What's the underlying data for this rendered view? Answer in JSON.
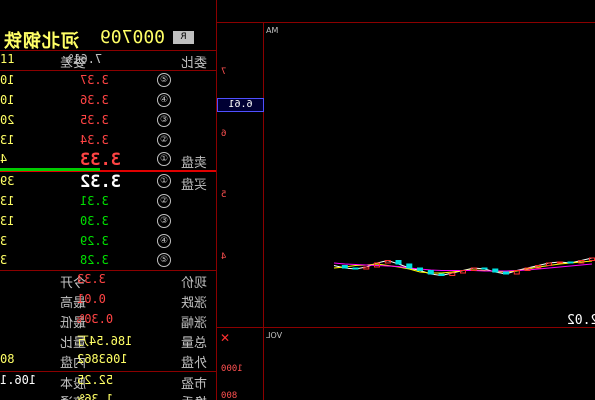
{
  "header": {
    "stock_name": "河北钢铁",
    "stock_code": "000709",
    "badge": "R"
  },
  "order_book": {
    "header_left": "11",
    "header_ratio_value": "7.61%",
    "header_ratio_label": "委差",
    "header_label": "委比",
    "sell_label": "卖盘",
    "buy_label": "买盘",
    "sells": [
      {
        "index": "⑤",
        "price": "3.37",
        "volume": "10"
      },
      {
        "index": "④",
        "price": "3.36",
        "volume": "10"
      },
      {
        "index": "③",
        "price": "3.35",
        "volume": "20"
      },
      {
        "index": "②",
        "price": "3.34",
        "volume": "13"
      },
      {
        "index": "①",
        "price": "3.33",
        "volume": "4"
      }
    ],
    "buys": [
      {
        "index": "①",
        "price": "3.32",
        "volume": "39"
      },
      {
        "index": "②",
        "price": "3.31",
        "volume": "13"
      },
      {
        "index": "③",
        "price": "3.30",
        "volume": "13"
      },
      {
        "index": "④",
        "price": "3.29",
        "volume": "3"
      },
      {
        "index": "⑤",
        "price": "3.28",
        "volume": "3"
      }
    ]
  },
  "stats": [
    {
      "l_key": "现价",
      "r_val": "3.33",
      "r_key": "今开",
      "l_val": ""
    },
    {
      "l_key": "涨跌",
      "r_val": "0.01",
      "r_key": "最高",
      "l_val": ""
    },
    {
      "l_key": "涨幅",
      "r_val": "0.30%",
      "r_key": "最低",
      "l_val": ""
    },
    {
      "l_key": "总量",
      "r_val": "186.54万",
      "r_key": "量比",
      "l_val": ""
    },
    {
      "l_key": "外盘",
      "r_val": "1063862",
      "r_key": "内盘",
      "l_val": "80"
    },
    {
      "l_key": "市盈",
      "r_val": "52.25",
      "r_key": "股本",
      "l_val": "106.1"
    },
    {
      "l_key": "换手",
      "r_val": "1.36%",
      "r_key": "流通",
      "l_val": ""
    }
  ],
  "chart": {
    "ma_label": "MA",
    "vol_label": "VOL",
    "current_price_box": "6.61",
    "y_ticks": [
      "7",
      "6",
      "5",
      "4"
    ],
    "vol_ticks": [
      "1000",
      "800"
    ],
    "low_label": "2.02"
  },
  "chart_data": {
    "type": "line",
    "title": "",
    "xlabel": "",
    "ylabel": "",
    "ylim": [
      2,
      8
    ],
    "series": [
      {
        "values": [
          3.15,
          3.1,
          3.08,
          3.12,
          3.2,
          3.25,
          3.18,
          3.1,
          3.05,
          2.98,
          2.95,
          3.0,
          3.05,
          3.1,
          3.08,
          3.02,
          2.98,
          3.05,
          3.1,
          3.15,
          3.2,
          3.22,
          3.2,
          3.25,
          3.3
        ]
      },
      {
        "values": [
          3.1,
          3.12,
          3.15,
          3.16,
          3.18,
          3.15,
          3.12,
          3.08,
          3.02,
          3.0,
          3.0,
          3.02,
          3.05,
          3.06,
          3.05,
          3.03,
          3.02,
          3.04,
          3.08,
          3.12,
          3.15,
          3.18,
          3.2,
          3.22,
          3.24
        ]
      },
      {
        "values": [
          3.2,
          3.18,
          3.17,
          3.16,
          3.15,
          3.14,
          3.13,
          3.1,
          3.08,
          3.06,
          3.05,
          3.05,
          3.05,
          3.05,
          3.04,
          3.04,
          3.04,
          3.05,
          3.06,
          3.08,
          3.1,
          3.12,
          3.14,
          3.16,
          3.18
        ]
      }
    ],
    "colors": [
      "#ffffff",
      "#ffff00",
      "#ff00ff"
    ]
  }
}
